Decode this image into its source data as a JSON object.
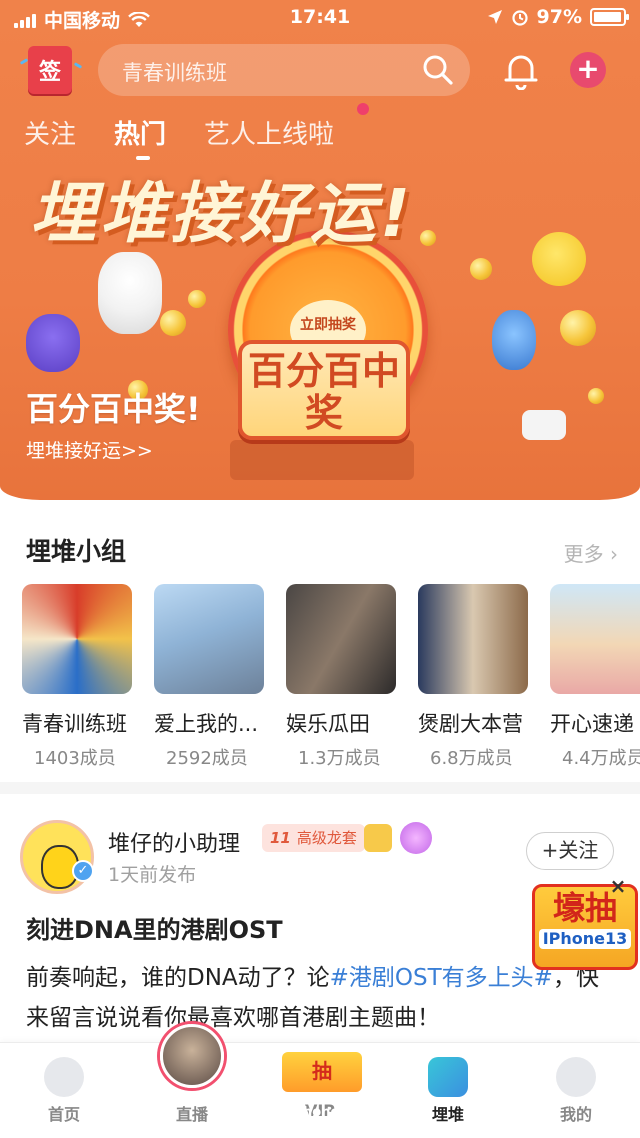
{
  "status_bar": {
    "carrier": "中国移动",
    "time": "17:41",
    "battery": "97%"
  },
  "header": {
    "sign_label": "签",
    "search_placeholder": "青春训练班",
    "plus_label": "+"
  },
  "tabs": [
    {
      "label": "关注",
      "active": false
    },
    {
      "label": "热门",
      "active": true
    },
    {
      "label": "艺人上线啦",
      "active": false
    }
  ],
  "banner": {
    "title": "埋堆接好运!",
    "wheel_center": "立即抽奖",
    "prize_text": "百分百中奖",
    "subtitle": "百分百中奖!",
    "link": "埋堆接好运>>"
  },
  "groups_section": {
    "title": "埋堆小组",
    "more": "更多",
    "items": [
      {
        "name": "青春训练班",
        "members": "1403成员"
      },
      {
        "name": "爱上我的...",
        "members": "2592成员"
      },
      {
        "name": "娱乐瓜田",
        "members": "1.3万成员"
      },
      {
        "name": "煲剧大本营",
        "members": "6.8万成员"
      },
      {
        "name": "开心速递",
        "members": "4.4万成员"
      }
    ]
  },
  "post": {
    "author": "堆仔的小助理",
    "level_num": "11",
    "level_label": "高级龙套",
    "time": "1天前发布",
    "follow": "+关注",
    "title": "刻进DNA里的港剧OST",
    "body_prefix": "前奏响起，谁的DNA动了？论",
    "tag": "#港剧OST有多上头#",
    "body_suffix": "，快来留言说说看你最喜欢哪首港剧主题曲！"
  },
  "float_ad": {
    "text": "壕抽",
    "sub": "IPhone13"
  },
  "tabbar": [
    {
      "label": "首页",
      "active": false
    },
    {
      "label": "直播",
      "active": false
    },
    {
      "label": "VIP",
      "active": false
    },
    {
      "label": "埋堆",
      "active": true
    },
    {
      "label": "我的",
      "active": false
    }
  ],
  "vip_badge": "抽",
  "colors": {
    "brand_orange": "#ee7d45",
    "tag_blue": "#3a7fd6",
    "accent_pink": "#e84a6e"
  }
}
